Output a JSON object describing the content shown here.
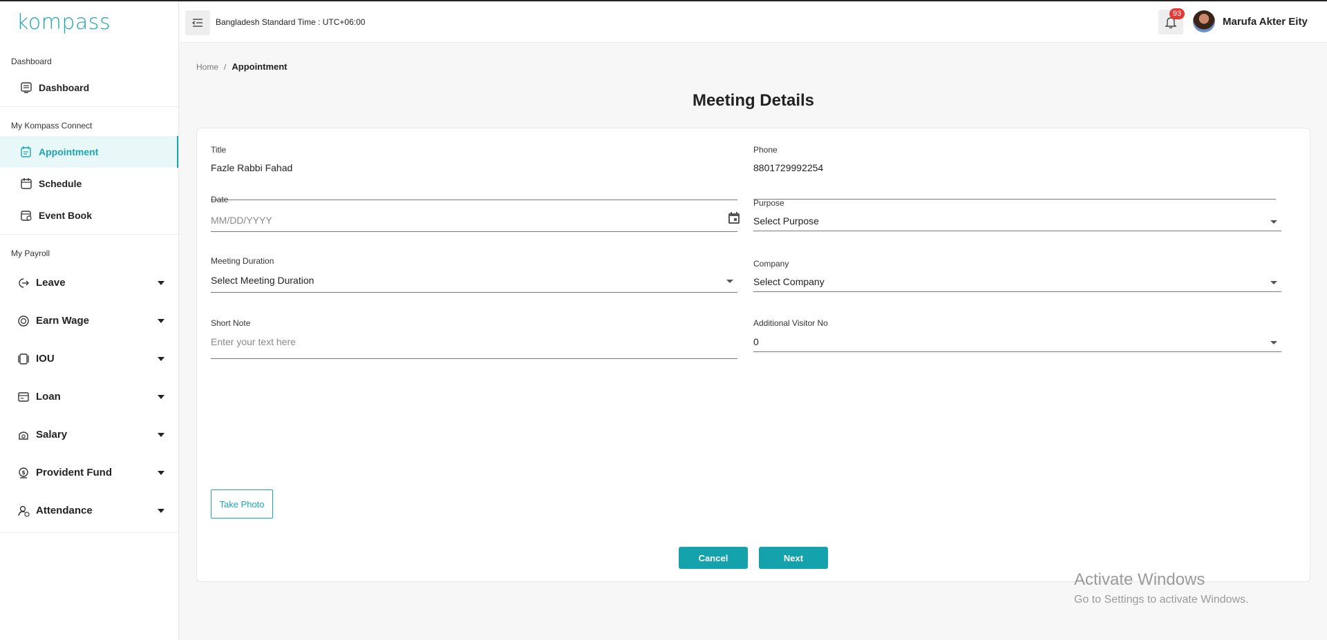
{
  "app": {
    "logo": "kompass"
  },
  "header": {
    "timezone": "Bangladesh Standard Time : UTC+06:00",
    "notification_count": "93",
    "user_name": "Marufa Akter Eity"
  },
  "sidebar": {
    "sections": [
      {
        "title": "Dashboard",
        "items": [
          {
            "label": "Dashboard",
            "icon": "dashboard-icon"
          }
        ]
      },
      {
        "title": "My Kompass Connect",
        "items": [
          {
            "label": "Appointment",
            "icon": "appointment-icon",
            "active": true
          },
          {
            "label": "Schedule",
            "icon": "calendar-icon"
          },
          {
            "label": "Event Book",
            "icon": "event-book-icon"
          }
        ]
      },
      {
        "title": "My Payroll",
        "items": [
          {
            "label": "Leave",
            "icon": "leave-icon"
          },
          {
            "label": "Earn Wage",
            "icon": "earn-wage-icon"
          },
          {
            "label": "IOU",
            "icon": "iou-icon"
          },
          {
            "label": "Loan",
            "icon": "loan-icon"
          },
          {
            "label": "Salary",
            "icon": "salary-icon"
          },
          {
            "label": "Provident Fund",
            "icon": "provident-fund-icon"
          },
          {
            "label": "Attendance",
            "icon": "attendance-icon"
          }
        ]
      }
    ],
    "accent_color": "#1aa5b0"
  },
  "breadcrumb": {
    "home": "Home",
    "separator": "/",
    "current": "Appointment"
  },
  "page_title": "Meeting Details",
  "form": {
    "title": {
      "label": "Title",
      "value": "Fazle Rabbi Fahad"
    },
    "phone": {
      "label": "Phone",
      "value": "8801729992254"
    },
    "date": {
      "label": "Date",
      "placeholder": "MM/DD/YYYY"
    },
    "purpose": {
      "label": "Purpose",
      "value": "Select Purpose"
    },
    "meeting_duration": {
      "label": "Meeting Duration",
      "value": "Select Meeting Duration"
    },
    "company": {
      "label": "Company",
      "value": "Select Company"
    },
    "short_note": {
      "label": "Short Note",
      "placeholder": "Enter your text here"
    },
    "additional_visitor": {
      "label": "Additional Visitor No",
      "value": "0"
    },
    "take_photo": "Take Photo",
    "cancel": "Cancel",
    "next": "Next"
  },
  "watermark": {
    "line1": "Activate Windows",
    "line2": "Go to Settings to activate Windows."
  }
}
